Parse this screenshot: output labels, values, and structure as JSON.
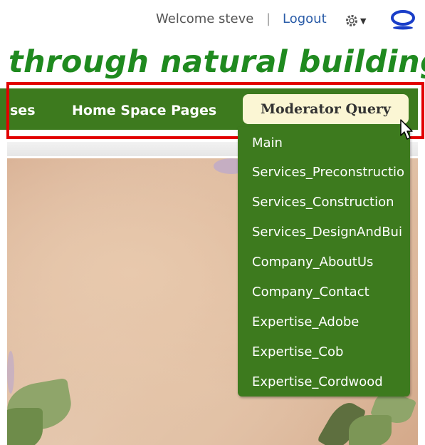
{
  "header": {
    "welcome_text": "Welcome steve",
    "separator": "|",
    "logout_label": "Logout",
    "settings_icon": "gear-icon",
    "logo_icon": "o-logo-icon"
  },
  "tagline": "through natural building",
  "nav": {
    "items": [
      {
        "label": "ses"
      },
      {
        "label": "Home Space Pages"
      }
    ],
    "active_label": "Moderator Query"
  },
  "dropdown": {
    "items": [
      "Main",
      "Services_Preconstructio",
      "Services_Construction",
      "Services_DesignAndBui",
      "Company_AboutUs",
      "Company_Contact",
      "Expertise_Adobe",
      "Expertise_Cob",
      "Expertise_Cordwood"
    ]
  },
  "colors": {
    "nav_green": "#3d7a1e",
    "tagline_green": "#1f8a1f",
    "active_tab_bg": "#fbf6d4",
    "highlight_red": "#e20000"
  }
}
